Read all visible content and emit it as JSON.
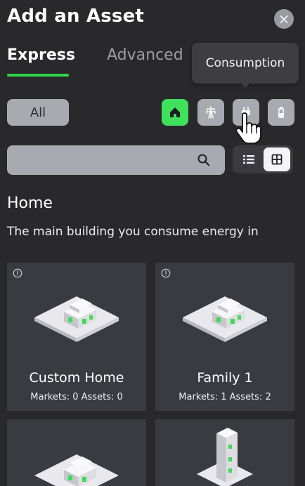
{
  "dialog": {
    "title": "Add an Asset",
    "close_symbol": "×"
  },
  "tabs": [
    {
      "label": "Express",
      "active": true
    },
    {
      "label": "Advanced",
      "active": false
    }
  ],
  "tooltip": {
    "text": "Consumption"
  },
  "filters": {
    "all_label": "All",
    "buttons": [
      {
        "icon": "home-icon",
        "active": true
      },
      {
        "icon": "grid-tower-icon",
        "active": false
      },
      {
        "icon": "plug-icon",
        "active": false
      },
      {
        "icon": "battery-icon",
        "active": false
      }
    ]
  },
  "search": {
    "value": "",
    "placeholder": ""
  },
  "view": {
    "selected": "grid"
  },
  "section": {
    "title": "Home",
    "description": "The main building you consume energy in"
  },
  "cards": [
    {
      "name": "Custom Home",
      "meta": "Markets: 0 Assets: 0"
    },
    {
      "name": "Family 1",
      "meta": "Markets: 1 Assets: 2"
    }
  ],
  "colors": {
    "accent": "#3fe05c",
    "background": "#29292c",
    "card": "#3a3b41",
    "control": "#a9a9b2"
  }
}
